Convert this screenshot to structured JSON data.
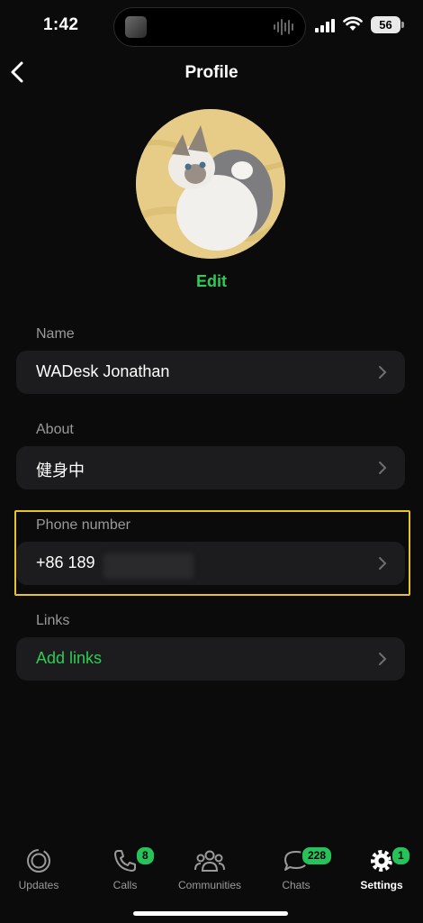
{
  "status_bar": {
    "time": "1:42",
    "battery": "56"
  },
  "nav": {
    "title": "Profile"
  },
  "profile": {
    "edit_label": "Edit",
    "name_label": "Name",
    "name_value": "WADesk Jonathan",
    "about_label": "About",
    "about_value": "健身中",
    "phone_label": "Phone number",
    "phone_value": "+86 189",
    "links_label": "Links",
    "links_value": "Add links"
  },
  "tabs": [
    {
      "label": "Updates",
      "badge": ""
    },
    {
      "label": "Calls",
      "badge": "8"
    },
    {
      "label": "Communities",
      "badge": ""
    },
    {
      "label": "Chats",
      "badge": "228"
    },
    {
      "label": "Settings",
      "badge": "1"
    }
  ],
  "colors": {
    "accent": "#2ecc55",
    "highlight": "#e7c52a",
    "field_bg": "#1c1c1e",
    "background": "#0b0b0b"
  }
}
